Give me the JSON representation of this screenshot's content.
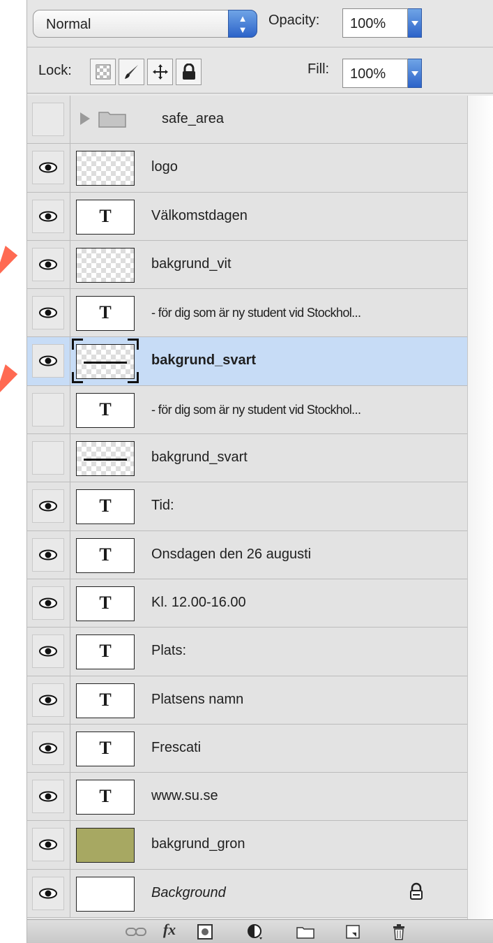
{
  "blend_mode": {
    "value": "Normal"
  },
  "opacity": {
    "label": "Opacity:",
    "value": "100%"
  },
  "lock": {
    "label": "Lock:"
  },
  "fill": {
    "label": "Fill:",
    "value": "100%"
  },
  "layers": [
    {
      "name": "safe_area",
      "kind": "group",
      "visible": false
    },
    {
      "name": "logo",
      "kind": "pixel",
      "visible": true
    },
    {
      "name": "Välkomstdagen",
      "kind": "text",
      "visible": true
    },
    {
      "name": "bakgrund_vit",
      "kind": "pixel",
      "visible": true
    },
    {
      "name": "- för dig som är ny student vid Stockhol...",
      "kind": "text",
      "visible": true
    },
    {
      "name": "bakgrund_svart",
      "kind": "shape",
      "visible": true,
      "selected": true
    },
    {
      "name": "- för dig som är ny student vid Stockhol...",
      "kind": "text",
      "visible": false
    },
    {
      "name": "bakgrund_svart",
      "kind": "shape",
      "visible": false
    },
    {
      "name": "Tid:",
      "kind": "text",
      "visible": true
    },
    {
      "name": "Onsdagen den 26 augusti",
      "kind": "text",
      "visible": true
    },
    {
      "name": "Kl. 12.00-16.00",
      "kind": "text",
      "visible": true
    },
    {
      "name": "Plats:",
      "kind": "text",
      "visible": true
    },
    {
      "name": "Platsens namn",
      "kind": "text",
      "visible": true
    },
    {
      "name": "Frescati",
      "kind": "text",
      "visible": true
    },
    {
      "name": "www.su.se",
      "kind": "text",
      "visible": true
    },
    {
      "name": "bakgrund_gron",
      "kind": "fill",
      "visible": true
    },
    {
      "name": "Background",
      "kind": "background",
      "visible": true,
      "locked": true
    }
  ],
  "text_thumb_glyph": "T",
  "colors": {
    "selected_row": "#c7dcf6",
    "green_fill": "#a7a862",
    "accent_arrow": "#ff6a52",
    "popup_blue": "#2c63c9"
  },
  "bottom_toolbar": {
    "fx_label": "fx"
  }
}
